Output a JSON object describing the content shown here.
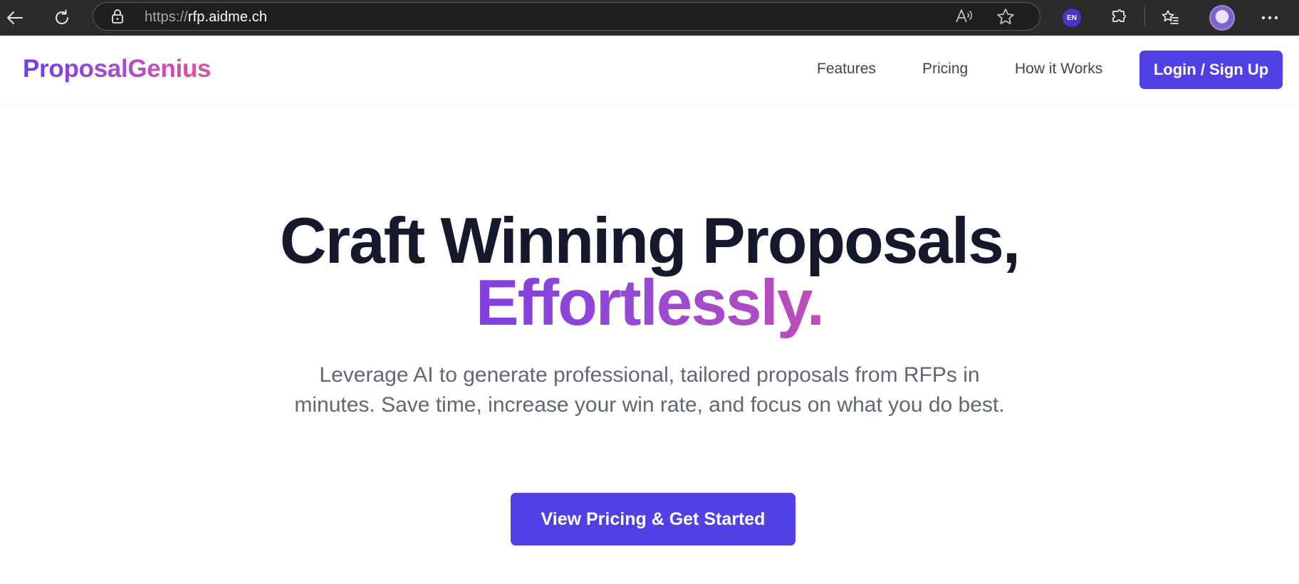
{
  "browser": {
    "url_scheme": "https://",
    "url_host": "rfp.aidme.ch",
    "lang_badge": "EN",
    "icons": [
      "back-arrow-icon",
      "refresh-icon",
      "lock-icon",
      "read-aloud-icon",
      "favorite-star-icon",
      "translate-extension-icon",
      "extensions-puzzle-icon",
      "favorites-list-icon",
      "profile-avatar",
      "more-options-icon"
    ]
  },
  "navbar": {
    "logo": "ProposalGenius",
    "links": [
      "Features",
      "Pricing",
      "How it Works"
    ],
    "login_label": "Login / Sign Up"
  },
  "hero": {
    "title_line1": "Craft Winning Proposals,",
    "title_line2": "Effortlessly.",
    "subtitle": "Leverage AI to generate professional, tailored proposals from RFPs in minutes. Save time, increase your win rate, and focus on what you do best.",
    "cta_label": "View Pricing & Get Started"
  },
  "colors": {
    "chrome_bg": "#2b2b2b",
    "primary": "#5040e6",
    "title": "#141a2c",
    "gradient_start": "#7f3fe0",
    "gradient_end": "#df4f9f",
    "subtitle": "#5f6777"
  }
}
